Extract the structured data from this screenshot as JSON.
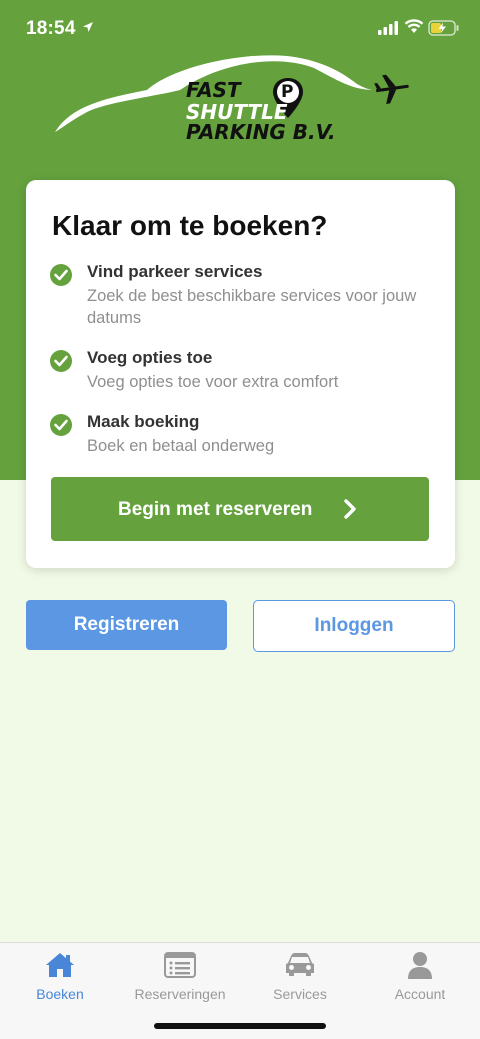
{
  "status_bar": {
    "time": "18:54"
  },
  "logo": {
    "line1": "FAST",
    "line2": "SHUTTLE",
    "line3": "PARKING B.V.",
    "pin_letter": "P"
  },
  "card": {
    "title": "Klaar om te boeken?",
    "steps": [
      {
        "title": "Vind parkeer services",
        "description": "Zoek de best beschikbare services voor jouw datums"
      },
      {
        "title": "Voeg opties toe",
        "description": "Voeg opties toe voor extra comfort"
      },
      {
        "title": "Maak boeking",
        "description": "Boek en betaal onderweg"
      }
    ],
    "cta_label": "Begin met reserveren"
  },
  "auth": {
    "register_label": "Registreren",
    "login_label": "Inloggen"
  },
  "tab_bar": {
    "tabs": [
      {
        "label": "Boeken",
        "icon": "home-icon",
        "active": true
      },
      {
        "label": "Reserveringen",
        "icon": "list-icon",
        "active": false
      },
      {
        "label": "Services",
        "icon": "car-icon",
        "active": false
      },
      {
        "label": "Account",
        "icon": "person-icon",
        "active": false
      }
    ]
  },
  "colors": {
    "brand_green": "#65a23e",
    "background_light": "#f1fae6",
    "accent_blue": "#5b97e2",
    "active_tab": "#4a86d8"
  }
}
